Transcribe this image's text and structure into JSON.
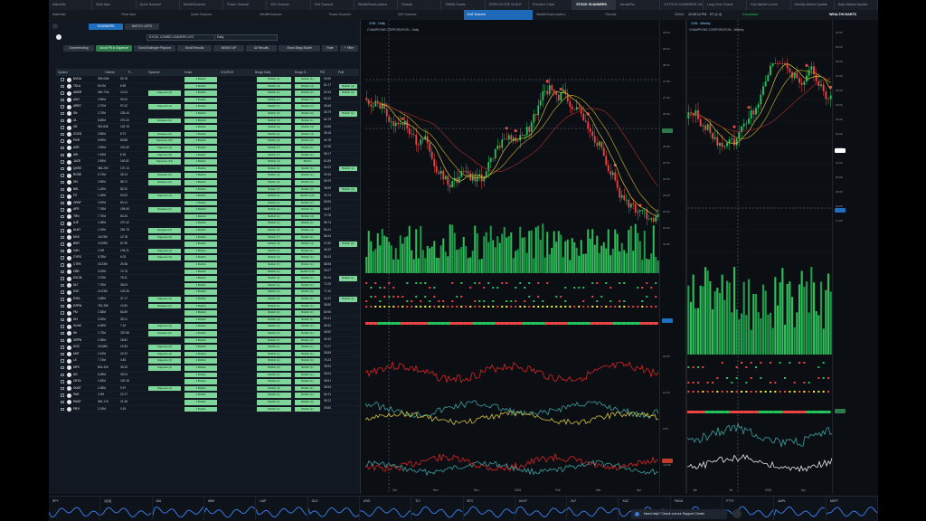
{
  "tabs": [
    "Watchlist",
    "Real Idea",
    "Quick Scanner",
    "WealthScanner",
    "Power Scanner",
    "WO Scanner",
    "Golf Scanner",
    "WealthScanLeaders",
    "Results",
    "SMMA Charts",
    "OPEN CLOSE SCALE",
    "Premium Chart",
    "STOCK SCANNERS",
    "WealthPro",
    "4-STOCK SCANNERS Grid",
    "Long Term Charts",
    "Key Market Levels",
    "Weekly Market Update",
    "Daily Market Update"
  ],
  "active_tab": "STOCK SCANNERS",
  "bar2": [
    "Watchlist",
    "Real Idea",
    "Quick Scanner",
    "WealthScanner",
    "Power Scanner",
    "WO Scanner",
    "Golf Scanner",
    "WealthScanLeaders",
    "Results",
    "SMMA Charts",
    "OPEN CLOSE SCALE",
    "Premium Chart"
  ],
  "active_bar2": "Golf Scanner",
  "status": {
    "time": "10:28:12 PM",
    "eta": "ET (1-4)",
    "connection": "Connected",
    "brand": "WEALTHCHARTS"
  },
  "scanner": {
    "toolbar": [
      "SCANNERS",
      "WATCH LISTS"
    ],
    "scan_select": "EXCEL COMBO LEADERS LIST",
    "interval_select": "Daily",
    "filters": [
      "Downtrending",
      "Scroll P8 in Squeeze",
      "Scroll Bollinger Pinpoint",
      "Scroll Results",
      "MOMO UP",
      "All Results",
      "Show Bingo Bullet",
      "Rate"
    ],
    "filter_button": "+ Filter",
    "columns": [
      "Symbol",
      "Volume",
      "P...",
      "Squeeze",
      "Scala",
      "VOL/RCH",
      "Bongo Daily",
      "Bongo S...",
      "P/E",
      "PoB"
    ],
    "rows": [
      {
        "sym": "NVDA",
        "vol": "399.00M",
        "pr": "93.78",
        "sq": "",
        "sc": "1 Bullish",
        "bd": "Bullish (1)",
        "bs": "Bullish (1)",
        "pe": "39.90",
        "pob": ""
      },
      {
        "sym": "TSLA",
        "vol": "94.0M",
        "pr": "8.95",
        "sq": "",
        "sc": "1 Bullish",
        "bd": "Bullish (4)",
        "bs": "Bullish (4)",
        "pe": "81.17",
        "pob": "Bullish (4)"
      },
      {
        "sym": "AMKR",
        "vol": "345.71M",
        "pr": "10.24",
        "sq": "Squeeze (2)",
        "sc": "1 Bullish",
        "bd": "Bullish (1)",
        "bs": "Bullish (1)",
        "pe": "52.34",
        "pob": "Bullish (2)"
      },
      {
        "sym": "AXO",
        "vol": "2.59M",
        "pr": "93.24",
        "sq": "",
        "sc": "1 Bullish",
        "bd": "Bullish (7)",
        "bs": "Bullish (7)",
        "pe": "53.42",
        "pob": ""
      },
      {
        "sym": "AREC",
        "vol": "2.72M",
        "pr": "97.42",
        "sq": "Squeeze (1)",
        "sc": "1 Bullish",
        "bd": "Bullish (7)",
        "bs": "Bullish (7)",
        "pe": "38.48",
        "pob": ""
      },
      {
        "sym": "SN",
        "vol": "2.79M",
        "pr": "225.44",
        "sq": "",
        "sc": "1 Bullish",
        "bd": "Bullish (2)",
        "bs": "Bullish (2)",
        "pe": "38.79",
        "pob": "Bullish (1)"
      },
      {
        "sym": "UL",
        "vol": "8.85M",
        "pr": "270.23",
        "sq": "Release (2)",
        "sc": "1 Bullish",
        "bd": "Bullish (5)",
        "bs": "Bullish (1)",
        "pe": "64.79",
        "pob": ""
      },
      {
        "sym": "GE",
        "vol": "951.83K",
        "pr": "129.78",
        "sq": "",
        "sc": "1 Bullish",
        "bd": "Bullish (4)",
        "bs": "Bullish (4)",
        "pe": "43.88",
        "pob": ""
      },
      {
        "sym": "CCEG",
        "vol": "2.86M",
        "pr": "8.72",
        "sq": "Release (3)",
        "sc": "1 Bullish",
        "bd": "Bullish (1)",
        "bs": "Bullish (4)",
        "pe": "38.18",
        "pob": ""
      },
      {
        "sym": "PGR",
        "vol": "5.69M",
        "pr": "83.88",
        "sq": "Squeeze (12)",
        "sc": "1 Bullish",
        "bd": "Bullish (4)",
        "bs": "Bullish (2)",
        "pe": "44.78",
        "pob": ""
      },
      {
        "sym": "ASR",
        "vol": "2.59M",
        "pr": "231.80",
        "sq": "Squeeze (4)",
        "sc": "1 Bullish",
        "bd": "Bullish (7)",
        "bs": "Bullish (1)",
        "pe": "47.66",
        "pob": ""
      },
      {
        "sym": "ARI",
        "vol": "1.93M",
        "pr": "8.18",
        "sq": "Squeeze (5)",
        "sc": "1 Bullish",
        "bd": "Bullish (7)",
        "bs": "Bullish (1)",
        "pe": "98.17",
        "pob": ""
      },
      {
        "sym": "JACE",
        "vol": "2.59M",
        "pr": "140.82",
        "sq": "Squeeze (13)",
        "sc": "1 Bullish",
        "bd": "Bullish (4)",
        "bs": "Bullish",
        "pe": "81.85",
        "pob": ""
      },
      {
        "sym": "QXSE",
        "vol": "384.20K",
        "pr": "107.14",
        "sq": "",
        "sc": "1 Bullish",
        "bd": "Bullish (2)",
        "bs": "Bullish (1)",
        "pe": "40.23",
        "pob": "Bullish (1)"
      },
      {
        "sym": "ROSE",
        "vol": "6.73M",
        "pr": "28.13",
        "sq": "Release (2)",
        "sc": "1 Bullish",
        "bd": "Bullish (3)",
        "bs": "Bullish (1)",
        "pe": "39.39",
        "pob": ""
      },
      {
        "sym": "GN",
        "vol": "2.89M",
        "pr": "88.72",
        "sq": "Release (2)",
        "sc": "1 Bullish",
        "bd": "Bullish (3)",
        "bs": "Bullish (2)",
        "pe": "59.29",
        "pob": ""
      },
      {
        "sym": "NEL",
        "vol": "1.15M",
        "pr": "82.22",
        "sq": "",
        "sc": "1 Bullish",
        "bd": "Bullish (7)",
        "bs": "Bullish (2)",
        "pe": "38.65",
        "pob": "Bullish (3)"
      },
      {
        "sym": "PZ",
        "vol": "1.18M",
        "pr": "90.52",
        "sq": "Squeeze (1)",
        "sc": "1 Bullish",
        "bd": "Bullish (1)",
        "bs": "Bullish (10)",
        "pe": "39.74",
        "pob": ""
      },
      {
        "sym": "OPAP",
        "vol": "2.92M",
        "pr": "83.14",
        "sq": "",
        "sc": "1 Bullish",
        "bd": "Bullish (1)",
        "bs": "Bullish (2)",
        "pe": "68.55",
        "pob": ""
      },
      {
        "sym": "AFR",
        "vol": "7.78M",
        "pr": "159.63",
        "sq": "Release (1)",
        "sc": "1 Bullish",
        "bd": "Bullish (1)",
        "bs": "Bullish (1)",
        "pe": "46.67",
        "pob": ""
      },
      {
        "sym": "TRN",
        "vol": "7.75M",
        "pr": "84.33",
        "sq": "",
        "sc": "1 Bullish",
        "bd": "Bullish (1)",
        "bs": "Bullish (4)",
        "pe": "70.76",
        "pob": ""
      },
      {
        "sym": "AJE",
        "vol": "1.38M",
        "pr": "237.42",
        "sq": "",
        "sc": "1 Bullish",
        "bd": "Bullish (1)",
        "bs": "Bullish (1)",
        "pe": "58.74",
        "pob": ""
      },
      {
        "sym": "ALNY",
        "vol": "1.03M",
        "pr": "254.78",
        "sq": "Release (3)",
        "sc": "1 Bullish",
        "bd": "Bullish (5)",
        "bs": "Bullish (4)",
        "pe": "83.41",
        "pob": ""
      },
      {
        "sym": "MXX",
        "vol": "16.03M",
        "pr": "12.78",
        "sq": "Squeeze (2)",
        "sc": "1 Bullish",
        "bd": "Bullish (7)",
        "bs": "Bullish (1)",
        "pe": "88.44",
        "pob": ""
      },
      {
        "sym": "BWT",
        "vol": "10.69M",
        "pr": "87.99",
        "sq": "",
        "sc": "1 Bullish",
        "bd": "Bullish (3)",
        "bs": "Bullish (4)",
        "pe": "47.82",
        "pob": "Bullish (2)"
      },
      {
        "sym": "CAH",
        "vol": "2.2M",
        "pr": "133.21",
        "sq": "Squeeze (1)",
        "sc": "1 Bullish",
        "bd": "Bullish (1)",
        "bs": "Bullish (1)",
        "pe": "46.32",
        "pob": ""
      },
      {
        "sym": "CYRX",
        "vol": "5.78M",
        "pr": "6.03",
        "sq": "Squeeze (2)",
        "sc": "1 Bullish",
        "bd": "Bullish (3)",
        "bs": "Bullish (1)",
        "pe": "58.43",
        "pob": ""
      },
      {
        "sym": "CTRX",
        "vol": "16.33M",
        "pr": "29.38",
        "sq": "",
        "sc": "1 Bullish",
        "bd": "Bullish (7)",
        "bs": "Bullish (1)",
        "pe": "88.98",
        "pob": ""
      },
      {
        "sym": "CBB",
        "vol": "3.33M",
        "pr": "74.76",
        "sq": "",
        "sc": "1 Bullish",
        "bd": "Bullish (1)",
        "bs": "Bullish (10)",
        "pe": "39.07",
        "pob": ""
      },
      {
        "sym": "DXCM",
        "vol": "3.76M",
        "pr": "78.11",
        "sq": "",
        "sc": "1 Bullish",
        "bd": "Bullish (2)",
        "bs": "Bullish (1)",
        "pe": "80.44",
        "pob": "Bullish (1)"
      },
      {
        "sym": "DLT",
        "vol": "7.78M",
        "pr": "38.04",
        "sq": "",
        "sc": "1 Bullish",
        "bd": "Bullish (1)",
        "bs": "Bullish (1)",
        "pe": "71.09",
        "pob": ""
      },
      {
        "sym": "EXE",
        "vol": "14.93M",
        "pr": "103.35",
        "sq": "",
        "sc": "1 Bullish",
        "bd": "Bullish (1)",
        "bs": "Bullish (2)",
        "pe": "77.40",
        "pob": ""
      },
      {
        "sym": "EXEL",
        "vol": "3.38M",
        "pr": "37.17",
        "sq": "Squeeze (2)",
        "sc": "1 Bullish",
        "bd": "Bullish (2)",
        "bs": "Bullish (1)",
        "pe": "44.22",
        "pob": "Bullish (1)"
      },
      {
        "sym": "EZPW",
        "vol": "781.39K",
        "pr": "14.83",
        "sq": "Release (2)",
        "sc": "1 Bullish",
        "bd": "Bullish (1)",
        "bs": "Bullish (1)",
        "pe": "38.80",
        "pob": ""
      },
      {
        "sym": "FM",
        "vol": "2.38M",
        "pr": "84.89",
        "sq": "",
        "sc": "1 Bullish",
        "bd": "Bullish (1)",
        "bs": "Bullish (1)",
        "pe": "80.96",
        "pob": ""
      },
      {
        "sym": "GH",
        "vol": "3.09M",
        "pr": "35.21",
        "sq": "",
        "sc": "1 Bullish",
        "bd": "Bullish (3)",
        "bs": "Bullish (1)",
        "pe": "83.41",
        "pob": ""
      },
      {
        "sym": "GLNG",
        "vol": "6.39M",
        "pr": "7.24",
        "sq": "Squeeze (4)",
        "sc": "1 Bullish",
        "bd": "Bullish (2)",
        "bs": "Bullish (1)",
        "pe": "38.32",
        "pob": ""
      },
      {
        "sym": "HII",
        "vol": "1.73M",
        "pr": "220.58",
        "sq": "Release (2)",
        "sc": "1 Bullish",
        "bd": "Bullish (1)",
        "bs": "Bullish (1)",
        "pe": "48.52",
        "pob": ""
      },
      {
        "sym": "GRPN",
        "vol": "1.98M",
        "pr": "18.82",
        "sq": "",
        "sc": "1 Bullish",
        "bd": "Bullish (7)",
        "bs": "Bullish (2)",
        "pe": "40.32",
        "pob": ""
      },
      {
        "sym": "KOC",
        "vol": "18.48M",
        "pr": "19.35",
        "sq": "Squeeze (2)",
        "sc": "1 Bullish",
        "bd": "Bullish (1)",
        "bs": "Bullish (1)",
        "pe": "71.07",
        "pob": ""
      },
      {
        "sym": "KMT",
        "vol": "4.10M",
        "pr": "24.33",
        "sq": "Squeeze (4)",
        "sc": "1 Bullish",
        "bd": "Bullish (1)",
        "bs": "Bullish (1)",
        "pe": "38.89",
        "pob": ""
      },
      {
        "sym": "LX",
        "vol": "7.74M",
        "pr": "4.83",
        "sq": "Squeeze (1)",
        "sc": "1 Bullish",
        "bd": "Bullish (1)",
        "bs": "Bullish (1)",
        "pe": "76.23",
        "pob": ""
      },
      {
        "sym": "MPX",
        "vol": "824.42K",
        "pr": "39.33",
        "sq": "Squeeze (2)",
        "sc": "1 Bullish",
        "bd": "Bullish (2)",
        "bs": "Bullish (1)",
        "pe": "38.94",
        "pob": ""
      },
      {
        "sym": "NG",
        "vol": "6.08M",
        "pr": "39.03",
        "sq": "",
        "sc": "1 Bullish",
        "bd": "Bullish (1)",
        "bs": "Bullish (1)",
        "pe": "28.04",
        "pob": ""
      },
      {
        "sym": "OKTA",
        "vol": "1.83M",
        "pr": "100.18",
        "sq": "",
        "sc": "1 Bullish",
        "bd": "Bullish (1)",
        "bs": "Bullish (1)",
        "pe": "38.91",
        "pob": ""
      },
      {
        "sym": "OUST",
        "vol": "2.08M",
        "pr": "9.97",
        "sq": "Squeeze (1)",
        "sc": "1 Bullish",
        "bd": "Bullish (3)",
        "bs": "Bullish (1)",
        "pe": "38.53",
        "pob": ""
      },
      {
        "sym": "PAH",
        "vol": "2.9M",
        "pr": "22.17",
        "sq": "",
        "sc": "1 Bullish",
        "bd": "Bullish (1)",
        "bs": "Bullish (1)",
        "pe": "84.41",
        "pob": ""
      },
      {
        "sym": "PAGP",
        "vol": "984.17K",
        "pr": "21.38",
        "sq": "",
        "sc": "1 Bullish",
        "bd": "Bullish (1)",
        "bs": "Bullish (2)",
        "pe": "38.12",
        "pob": ""
      },
      {
        "sym": "PBYI",
        "vol": "2.03M",
        "pr": "4.15",
        "sq": "",
        "sc": "1 Bullish",
        "bd": "Bullish (1)",
        "bs": "Bullish (1)",
        "pe": "39.80",
        "pob": ""
      }
    ],
    "footer": "Last Updated: Recently, 10:28 (ET)"
  },
  "chartA": {
    "title": "CHAMPIONS CORPORATION - Daily",
    "symbol": "CHN - Daily",
    "price_labels": [
      "29.00",
      "28.50",
      "28.00",
      "27.50",
      "27.00",
      "26.50",
      "26.00",
      "25.50",
      "25.00",
      "24.50",
      "24.00",
      "23.50",
      "23.00",
      "22.50"
    ],
    "osc_labels": [
      "20.00",
      "10.00",
      "0.00",
      "-10.00"
    ],
    "months": [
      "Oct",
      "Nov",
      "Dec",
      "2025",
      "Feb",
      "Mar",
      "Apr"
    ]
  },
  "chartB": {
    "title": "CHAMPIONS CORPORATION - Weekly",
    "symbol": "CHN - Weekly",
    "price_labels": [
      "30.00",
      "29.00",
      "28.00",
      "27.00",
      "26.00",
      "25.00",
      "24.00",
      "23.00",
      "22.00",
      "21.00",
      "20.00",
      "19.00",
      "18.00",
      "17.00"
    ],
    "months": [
      "Jan",
      "Jul",
      "2025",
      "Apr"
    ]
  },
  "colors": {
    "bull": "#22c55e",
    "bear": "#ef4444",
    "accent": "#1e6ab8",
    "sma": "#d4c23a"
  },
  "watchlist": [
    {
      "sym": "SPY",
      "color": "#3b82f6"
    },
    {
      "sym": "QQQ",
      "color": "#3b82f6"
    },
    {
      "sym": "DIA",
      "color": "#3b82f6"
    },
    {
      "sym": "IWM",
      "color": "#3b82f6"
    },
    {
      "sym": "UUP",
      "color": "#3b82f6"
    },
    {
      "sym": "GLD",
      "color": "#3b82f6"
    },
    {
      "sym": "USO",
      "color": "#3b82f6"
    },
    {
      "sym": "TLT",
      "color": "#3b82f6"
    },
    {
      "sym": "BTC",
      "color": "#3b82f6"
    },
    {
      "sym": "UVXY",
      "color": "#3b82f6"
    },
    {
      "sym": "XLF",
      "color": "#3b82f6"
    },
    {
      "sym": "XLE",
      "color": "#3b82f6"
    },
    {
      "sym": "FNGU",
      "color": "#3b82f6"
    },
    {
      "sym": "FTTY",
      "color": "#3b82f6"
    },
    {
      "sym": "AAPL",
      "color": "#3b82f6"
    },
    {
      "sym": "MSFT",
      "color": "#3b82f6"
    }
  ],
  "help": "Need help? Check out our Support Center"
}
